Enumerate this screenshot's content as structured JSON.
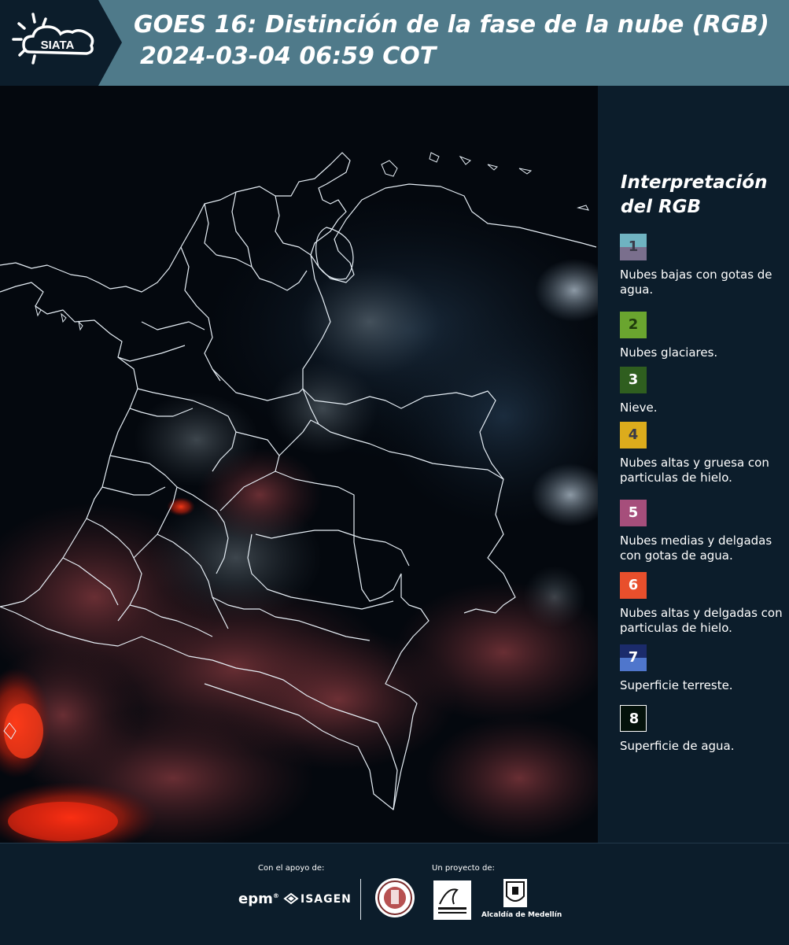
{
  "header": {
    "logo_text": "SIATA",
    "title_line1": "GOES 16: Distinción de la fase de la nube (RGB)",
    "title_line2": "2024-03-04 06:59 COT"
  },
  "legend": {
    "title_line1": "Interpretación",
    "title_line2": "del RGB",
    "items": [
      {
        "num": "1",
        "label": "Nubes bajas con gotas de agua.",
        "color_top": "#6fb3c1",
        "color_bottom": "#7a6f8d",
        "num_color": "#3a3a48"
      },
      {
        "num": "2",
        "label": "Nubes glaciares.",
        "color_top": "#6aa52f",
        "color_bottom": "#6aa52f",
        "num_color": "#1e3a0c"
      },
      {
        "num": "3",
        "label": "Nieve.",
        "color_top": "#2f5e1f",
        "color_bottom": "#2f5e1f",
        "num_color": "#ffffff"
      },
      {
        "num": "4",
        "label": "Nubes altas y gruesa con particulas de hielo.",
        "color_top": "#dcac1c",
        "color_bottom": "#dcac1c",
        "num_color": "#3a3a48"
      },
      {
        "num": "5",
        "label": "Nubes medias y delgadas con gotas de agua.",
        "color_top": "#a64e7b",
        "color_bottom": "#a64e7b",
        "num_color": "#ffffff"
      },
      {
        "num": "6",
        "label": "Nubes altas y delgadas con particulas de hielo.",
        "color_top": "#e84f2c",
        "color_bottom": "#e84f2c",
        "num_color": "#ffffff"
      },
      {
        "num": "7",
        "label": "Superficie terreste.",
        "color_top": "#1b2b6b",
        "color_bottom": "#4f76cc",
        "num_color": "#ffffff"
      },
      {
        "num": "8",
        "label": "Superficie de agua.",
        "color_top": "#04120b",
        "color_bottom": "#04120b",
        "num_color": "#ffffff"
      }
    ]
  },
  "footer": {
    "support_label": "Con el apoyo de:",
    "project_label": "Un proyecto de:",
    "epm": "epm",
    "isagen": "ISAGEN",
    "alcaldia": "Alcaldía de Medellín"
  }
}
